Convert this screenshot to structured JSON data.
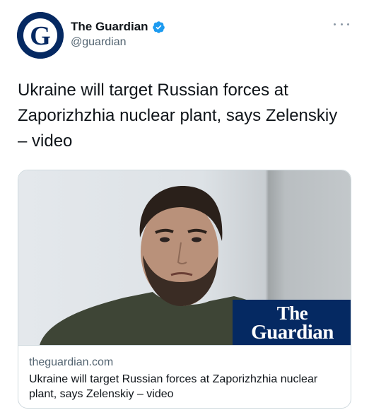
{
  "author": {
    "display_name": "The Guardian",
    "handle": "@guardian",
    "verified": true,
    "avatar_letter": "G"
  },
  "tweet": {
    "text": "Ukraine will target Russian forces at Zaporizhzhia nuclear plant, says Zelenskiy – video"
  },
  "card": {
    "domain": "theguardian.com",
    "title": "Ukraine will target Russian forces at Zaporizhzhia nuclear plant, says Zelenskiy – video",
    "logo_line1": "The",
    "logo_line2": "Guardian"
  },
  "colors": {
    "brand": "#052962",
    "verified_blue": "#1d9bf0",
    "secondary_text": "#536471",
    "border": "#cfd9de"
  }
}
